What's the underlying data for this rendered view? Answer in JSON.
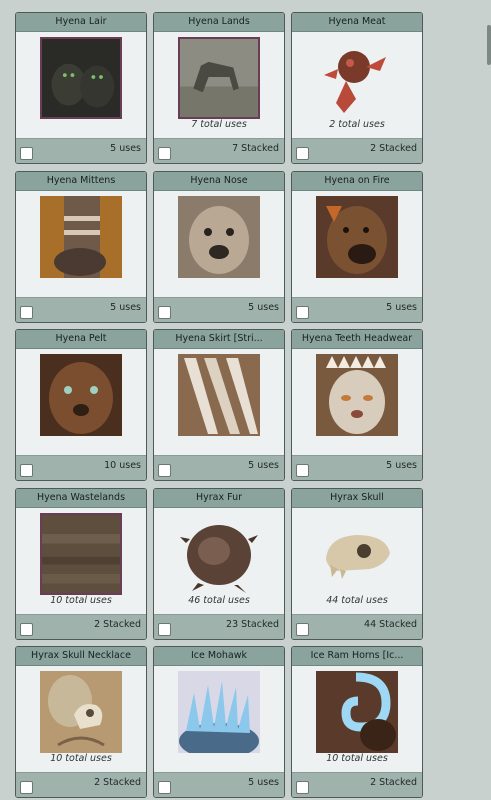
{
  "items": [
    {
      "name": "Hyena Lair",
      "total": "",
      "count": "5 uses",
      "icon": "hyena-lair-icon",
      "framed": true
    },
    {
      "name": "Hyena Lands",
      "total": "7 total uses",
      "count": "7 Stacked",
      "icon": "hyena-lands-icon",
      "framed": true
    },
    {
      "name": "Hyena Meat",
      "total": "2 total uses",
      "count": "2 Stacked",
      "icon": "hyena-meat-icon",
      "framed": false
    },
    {
      "name": "Hyena Mittens",
      "total": "",
      "count": "5 uses",
      "icon": "hyena-mittens-icon",
      "framed": false
    },
    {
      "name": "Hyena Nose",
      "total": "",
      "count": "5 uses",
      "icon": "hyena-nose-icon",
      "framed": false
    },
    {
      "name": "Hyena on Fire",
      "total": "",
      "count": "5 uses",
      "icon": "hyena-on-fire-icon",
      "framed": false
    },
    {
      "name": "Hyena Pelt",
      "total": "",
      "count": "10 uses",
      "icon": "hyena-pelt-icon",
      "framed": false
    },
    {
      "name": "Hyena Skirt [Stri...",
      "total": "",
      "count": "5 uses",
      "icon": "hyena-skirt-icon",
      "framed": false
    },
    {
      "name": "Hyena Teeth Headwear",
      "total": "",
      "count": "5 uses",
      "icon": "hyena-teeth-headwear-icon",
      "framed": false
    },
    {
      "name": "Hyena Wastelands",
      "total": "10 total uses",
      "count": "2 Stacked",
      "icon": "hyena-wastelands-icon",
      "framed": true
    },
    {
      "name": "Hyrax Fur",
      "total": "46 total uses",
      "count": "23 Stacked",
      "icon": "hyrax-fur-icon",
      "framed": false
    },
    {
      "name": "Hyrax Skull",
      "total": "44 total uses",
      "count": "44 Stacked",
      "icon": "hyrax-skull-icon",
      "framed": false
    },
    {
      "name": "Hyrax Skull Necklace",
      "total": "10 total uses",
      "count": "2 Stacked",
      "icon": "hyrax-skull-necklace-icon",
      "framed": false
    },
    {
      "name": "Ice Mohawk",
      "total": "",
      "count": "5 uses",
      "icon": "ice-mohawk-icon",
      "framed": false
    },
    {
      "name": "Ice Ram Horns [Ic...",
      "total": "10 total uses",
      "count": "2 Stacked",
      "icon": "ice-ram-horns-icon",
      "framed": false
    }
  ],
  "colors": {
    "page_bg": "#c8d1cd",
    "card_bg": "#eef1f1",
    "title_bar": "#8ba39d",
    "footer_bar": "#a0b2ac",
    "frame": "#6b3c55"
  }
}
